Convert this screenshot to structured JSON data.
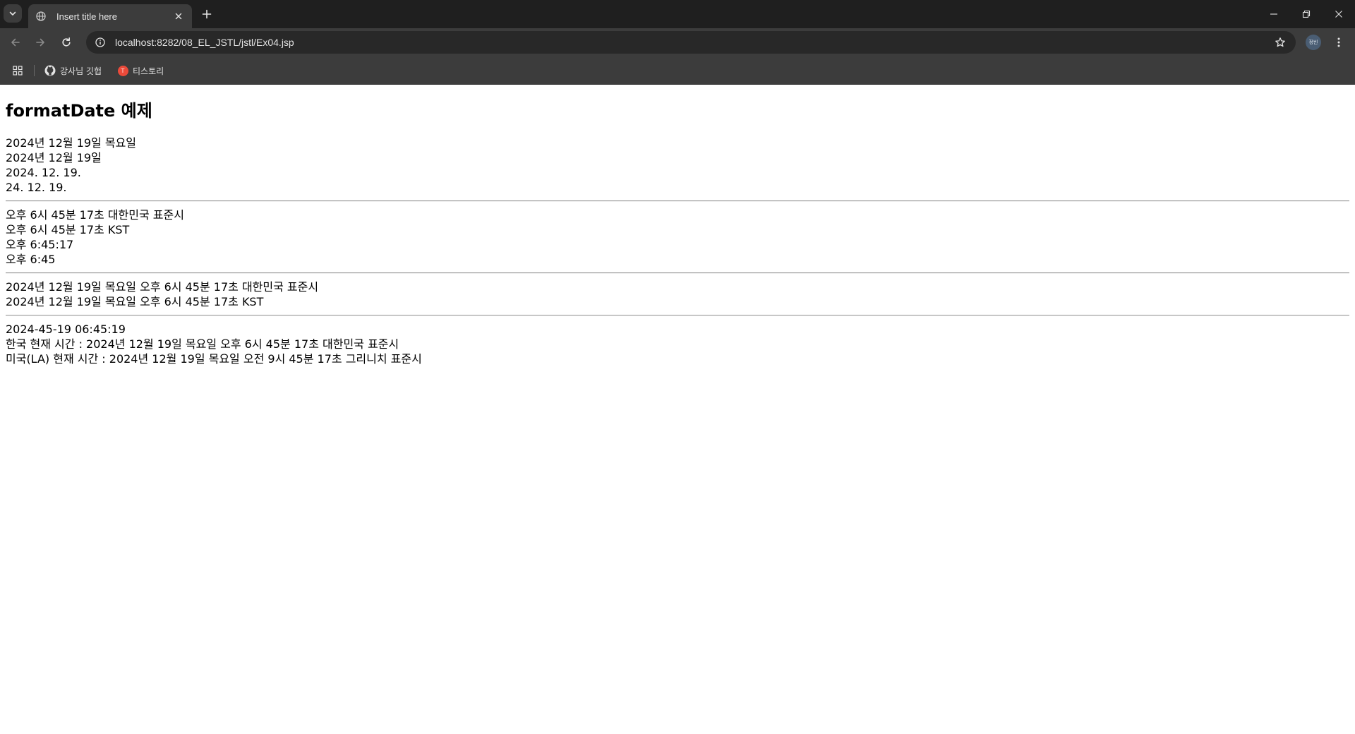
{
  "browser": {
    "tab": {
      "title": "Insert title here",
      "favicon": "globe-icon"
    },
    "url": "localhost:8282/08_EL_JSTL/jstl/Ex04.jsp",
    "profile_initials": "정빈",
    "bookmarks": [
      {
        "label": "강사님 깃헙",
        "icon": "github-icon"
      },
      {
        "label": "티스토리",
        "icon": "tistory-icon",
        "badge": "T"
      }
    ],
    "colors": {
      "tabstrip": "#1f1f1f",
      "toolbar": "#3c3c3c",
      "omnibox": "#282828",
      "tistory": "#eb4a3a"
    }
  },
  "page": {
    "title": "formatDate 예제",
    "date_block": [
      "2024년 12월 19일 목요일",
      "2024년 12월 19일",
      "2024. 12. 19.",
      "24. 12. 19."
    ],
    "time_block": [
      "오후 6시 45분 17초 대한민국 표준시",
      "오후 6시 45분 17초 KST",
      "오후 6:45:17",
      "오후 6:45"
    ],
    "datetime_block": [
      "2024년 12월 19일 목요일 오후 6시 45분 17초 대한민국 표준시",
      "2024년 12월 19일 목요일 오후 6시 45분 17초 KST"
    ],
    "custom_block": [
      "2024-45-19 06:45:19",
      "한국 현재 시간 : 2024년 12월 19일 목요일 오후 6시 45분 17초 대한민국 표준시",
      "미국(LA) 현재 시간 : 2024년 12월 19일 목요일 오전 9시 45분 17초 그리니치 표준시"
    ]
  }
}
